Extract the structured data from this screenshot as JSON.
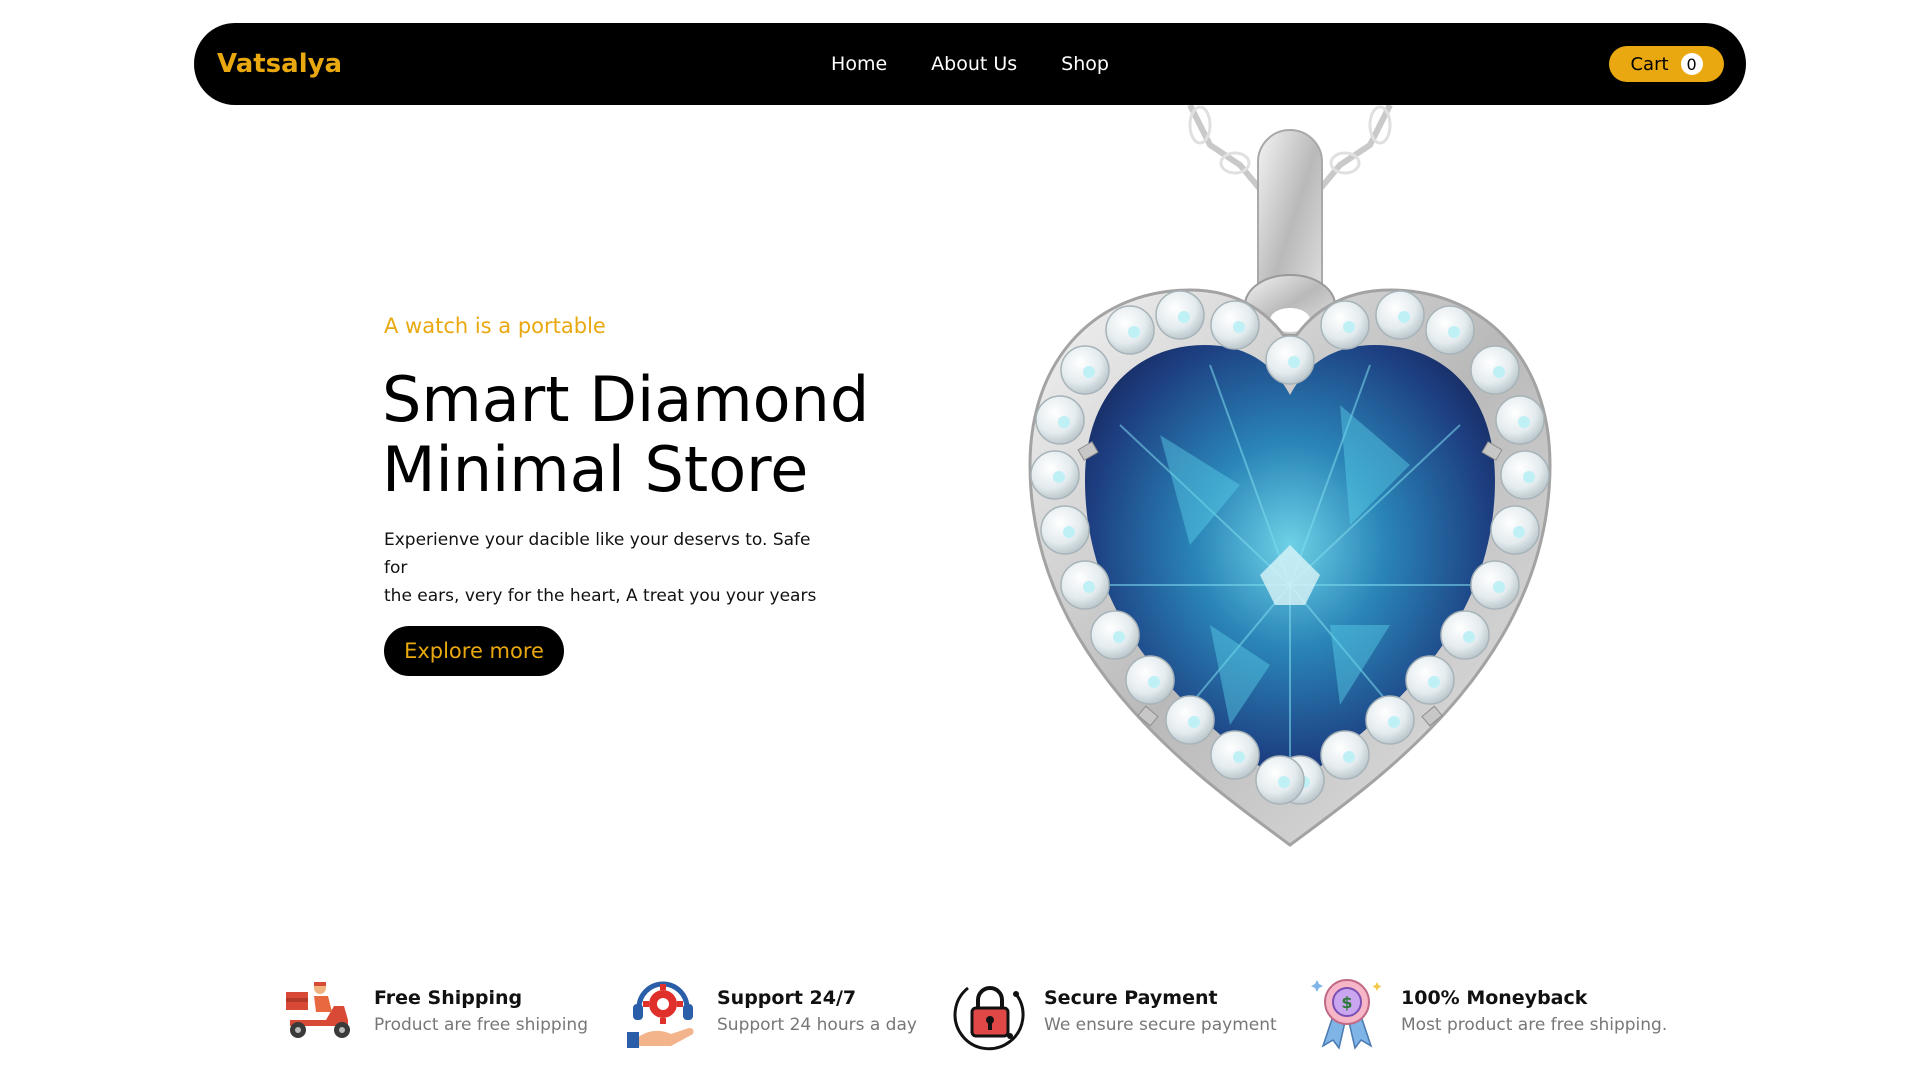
{
  "nav": {
    "brand": "Vatsalya",
    "links": [
      "Home",
      "About Us",
      "Shop"
    ],
    "cart_label": "Cart",
    "cart_count": "0"
  },
  "hero": {
    "tagline": "A watch is a portable",
    "title_line1": "Smart Diamond",
    "title_line2": "Minimal Store",
    "description_line1": "Experienve your dacible like your deservs to. Safe for",
    "description_line2": "the ears, very for the heart, A treat you your years",
    "cta": "Explore more"
  },
  "features": [
    {
      "icon": "delivery-scooter-icon",
      "title": "Free Shipping",
      "subtitle": "Product are free shipping"
    },
    {
      "icon": "support-gear-icon",
      "title": "Support 24/7",
      "subtitle": "Support 24 hours a day"
    },
    {
      "icon": "padlock-icon",
      "title": "Secure Payment",
      "subtitle": "We ensure secure payment"
    },
    {
      "icon": "money-badge-icon",
      "title": "100% Moneyback",
      "subtitle": "Most product are free shipping."
    }
  ],
  "colors": {
    "accent": "#e9a80f",
    "nav_bg": "#000000",
    "gem_blue": "#1f4e8c"
  }
}
